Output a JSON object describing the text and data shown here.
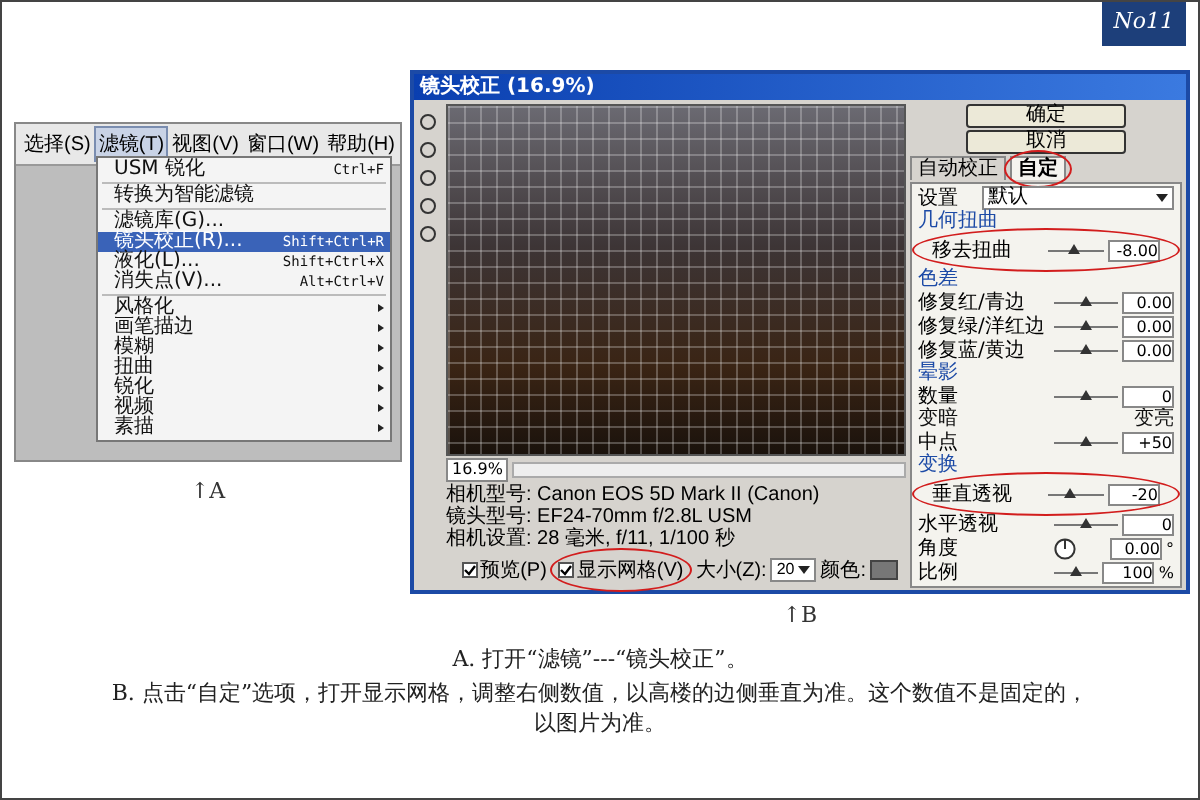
{
  "badge": "No11",
  "panel_a": {
    "menu_bar": [
      {
        "label": "选择(S)",
        "selected": false
      },
      {
        "label": "滤镜(T)",
        "selected": true
      },
      {
        "label": "视图(V)",
        "selected": false
      },
      {
        "label": "窗口(W)",
        "selected": false
      },
      {
        "label": "帮助(H)",
        "selected": false
      }
    ],
    "menu_items": [
      {
        "kind": "item",
        "label": "USM 锐化",
        "shortcut": "Ctrl+F",
        "selected": false
      },
      {
        "kind": "separator"
      },
      {
        "kind": "item",
        "label": "转换为智能滤镜",
        "selected": false
      },
      {
        "kind": "separator"
      },
      {
        "kind": "item",
        "label": "滤镜库(G)...",
        "selected": false
      },
      {
        "kind": "item",
        "label": "镜头校正(R)...",
        "shortcut": "Shift+Ctrl+R",
        "selected": true
      },
      {
        "kind": "item",
        "label": "液化(L)...",
        "shortcut": "Shift+Ctrl+X",
        "selected": false
      },
      {
        "kind": "item",
        "label": "消失点(V)...",
        "shortcut": "Alt+Ctrl+V",
        "selected": false
      },
      {
        "kind": "separator"
      },
      {
        "kind": "submenu",
        "label": "风格化"
      },
      {
        "kind": "submenu",
        "label": "画笔描边"
      },
      {
        "kind": "submenu",
        "label": "模糊"
      },
      {
        "kind": "submenu",
        "label": "扭曲"
      },
      {
        "kind": "submenu",
        "label": "锐化"
      },
      {
        "kind": "submenu",
        "label": "视频"
      },
      {
        "kind": "submenu",
        "label": "素描"
      }
    ],
    "caption": "↑A"
  },
  "panel_b": {
    "title": "镜头校正 (16.9%)",
    "buttons": [
      "确定",
      "取消"
    ],
    "tabs": [
      {
        "label": "自动校正",
        "selected": false,
        "circled": false
      },
      {
        "label": "自定",
        "selected": true,
        "circled": true
      }
    ],
    "settings": {
      "label": "设置",
      "value": "默认"
    },
    "sections": [
      {
        "title": "几何扭曲",
        "rows": [
          {
            "kind": "slider",
            "label": "移去扭曲",
            "value": "-8.00",
            "level": 0.45,
            "circled": true
          }
        ]
      },
      {
        "title": "色差",
        "rows": [
          {
            "kind": "slider",
            "label": "修复红/青边",
            "value": "0.00",
            "level": 0.5
          },
          {
            "kind": "slider",
            "label": "修复绿/洋红边",
            "value": "0.00",
            "level": 0.5
          },
          {
            "kind": "slider",
            "label": "修复蓝/黄边",
            "value": "0.00",
            "level": 0.5
          }
        ]
      },
      {
        "title": "晕影",
        "rows": [
          {
            "kind": "slider",
            "label": "数量",
            "value": "0",
            "level": 0.5
          },
          {
            "kind": "ends",
            "left": "变暗",
            "right": "变亮"
          },
          {
            "kind": "slider",
            "label": "中点",
            "value": "+50",
            "level": 0.5
          }
        ]
      },
      {
        "title": "变换",
        "rows": [
          {
            "kind": "slider",
            "label": "垂直透视",
            "value": "-20",
            "level": 0.4,
            "circled": true
          },
          {
            "kind": "slider",
            "label": "水平透视",
            "value": "0",
            "level": 0.5
          },
          {
            "kind": "angle",
            "label": "角度",
            "value": "0.00",
            "unit": "°"
          },
          {
            "kind": "slider",
            "label": "比例",
            "value": "100",
            "unit": "%",
            "level": 0.5
          }
        ]
      }
    ],
    "camera_info": [
      "相机型号: Canon EOS 5D Mark II (Canon)",
      "镜头型号: EF24-70mm f/2.8L USM",
      "相机设置: 28 毫米, f/11, 1/100 秒"
    ],
    "zoom": "16.9%",
    "checkboxes": [
      {
        "label": "预览(P)",
        "checked": true,
        "circled": false
      },
      {
        "label": "显示网格(V)",
        "checked": true,
        "circled": true
      }
    ],
    "grid_size": {
      "label": "大小(Z):",
      "value": "20"
    },
    "color_label": "颜色:",
    "caption": "↑B"
  },
  "captions": [
    "A. 打开“滤镜”---“镜头校正”。",
    "B. 点击“自定”选项，打开显示网格，调整右侧数值，以高楼的边侧垂直为准。这个数值不是固定的，以图片为准。"
  ]
}
